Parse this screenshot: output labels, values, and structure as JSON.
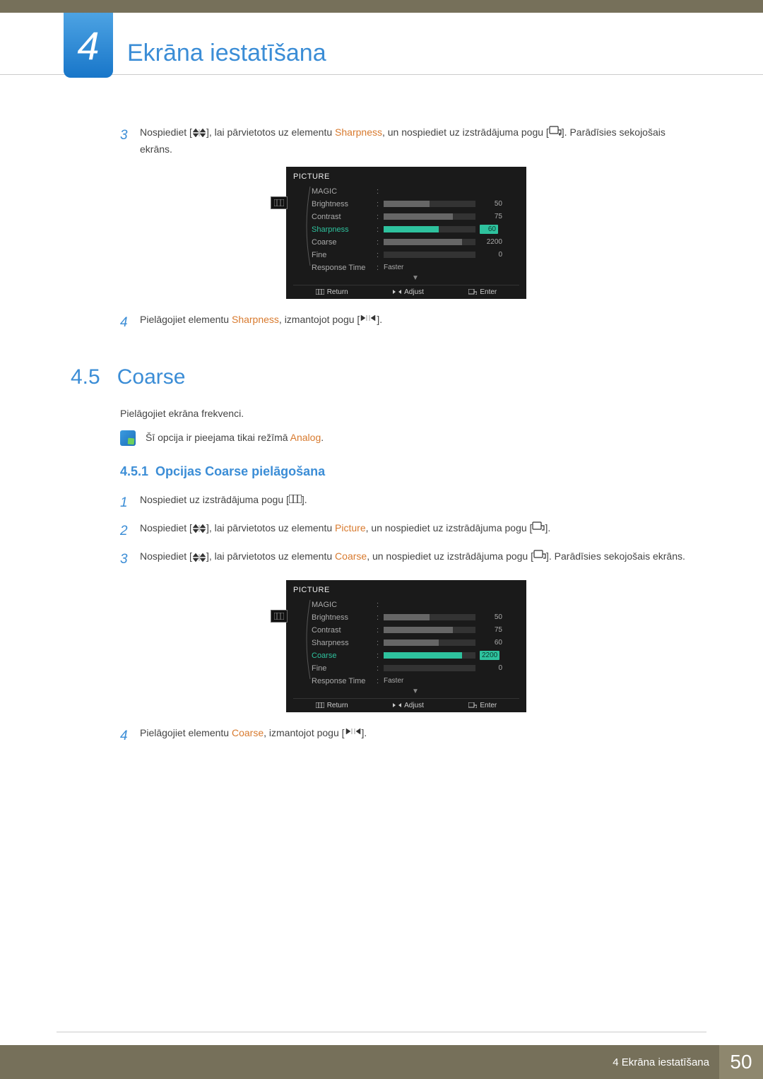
{
  "chapter": {
    "number": "4",
    "title": "Ekrāna iestatīšana"
  },
  "section_a": {
    "step3_pre": "Nospiediet [",
    "step3_mid": "], lai pārvietotos uz elementu ",
    "step3_kw": "Sharpness",
    "step3_post": ", un nospiediet uz izstrādājuma pogu [",
    "step3_end": "]. Parādīsies sekojošais ekrāns.",
    "step4_pre": "Pielāgojiet elementu ",
    "step4_kw": "Sharpness",
    "step4_post": ", izmantojot pogu [",
    "step4_end": "]."
  },
  "osd1": {
    "title": "PICTURE",
    "rows": {
      "magic": "MAGIC",
      "brightness": "Brightness",
      "contrast": "Contrast",
      "sharpness": "Sharpness",
      "coarse": "Coarse",
      "fine": "Fine",
      "response": "Response Time"
    },
    "vals": {
      "brightness": "50",
      "contrast": "75",
      "sharpness": "60",
      "coarse": "2200",
      "fine": "0",
      "response": "Faster"
    },
    "footer": {
      "return": "Return",
      "adjust": "Adjust",
      "enter": "Enter"
    }
  },
  "section_b": {
    "num": "4.5",
    "title": "Coarse",
    "p1": "Pielāgojiet ekrāna frekvenci.",
    "note_pre": "Šī opcija ir pieejama tikai režīmā ",
    "note_kw": "Analog",
    "note_post": ".",
    "sub_num": "4.5.1",
    "sub_title": "Opcijas Coarse pielāgošana",
    "s1_pre": "Nospiediet uz izstrādājuma pogu [",
    "s1_end": "].",
    "s2_pre": "Nospiediet [",
    "s2_mid": "], lai pārvietotos uz elementu ",
    "s2_kw": "Picture",
    "s2_post": ", un nospiediet uz izstrādājuma pogu [",
    "s2_end": "].",
    "s3_pre": "Nospiediet [",
    "s3_mid": "], lai pārvietotos uz elementu ",
    "s3_kw": "Coarse",
    "s3_post": ", un nospiediet uz izstrādājuma pogu [",
    "s3_end": "]. Parādīsies sekojošais ekrāns.",
    "s4_pre": "Pielāgojiet elementu ",
    "s4_kw": "Coarse",
    "s4_post": ", izmantojot pogu [",
    "s4_end": "]."
  },
  "osd2": {
    "title": "PICTURE",
    "rows": {
      "magic": "MAGIC",
      "brightness": "Brightness",
      "contrast": "Contrast",
      "sharpness": "Sharpness",
      "coarse": "Coarse",
      "fine": "Fine",
      "response": "Response Time"
    },
    "vals": {
      "brightness": "50",
      "contrast": "75",
      "sharpness": "60",
      "coarse": "2200",
      "fine": "0",
      "response": "Faster"
    },
    "footer": {
      "return": "Return",
      "adjust": "Adjust",
      "enter": "Enter"
    }
  },
  "footer": {
    "text": "4 Ekrāna iestatīšana",
    "page": "50"
  },
  "step_nums": {
    "n1": "1",
    "n2": "2",
    "n3": "3",
    "n4": "4"
  }
}
